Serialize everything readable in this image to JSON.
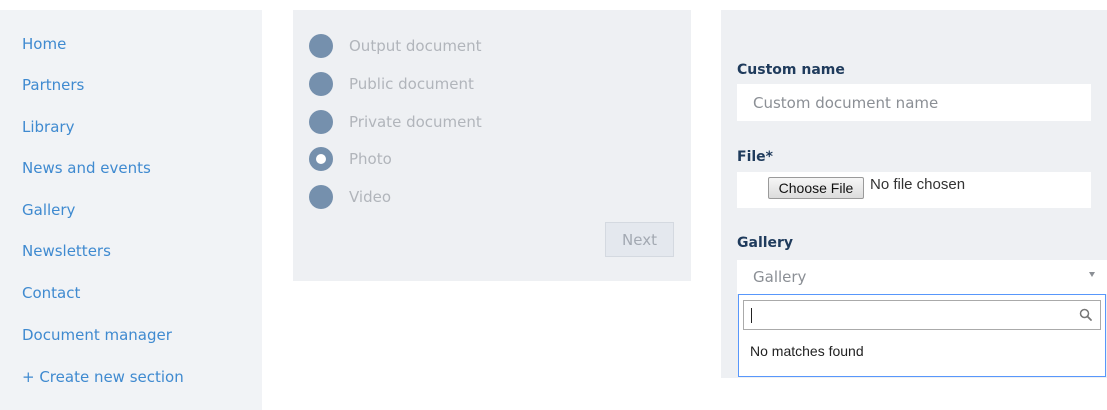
{
  "sidebar": {
    "items": [
      {
        "label": "Home"
      },
      {
        "label": "Partners"
      },
      {
        "label": "Library"
      },
      {
        "label": "News and events"
      },
      {
        "label": "Gallery"
      },
      {
        "label": "Newsletters"
      },
      {
        "label": "Contact"
      },
      {
        "label": "Document manager"
      },
      {
        "label": "+ Create new section"
      }
    ]
  },
  "document_type": {
    "options": [
      {
        "label": "Output document",
        "checked": false
      },
      {
        "label": "Public document",
        "checked": false
      },
      {
        "label": "Private document",
        "checked": false
      },
      {
        "label": "Photo",
        "checked": true
      },
      {
        "label": "Video",
        "checked": false
      }
    ],
    "next_label": "Next"
  },
  "form": {
    "custom_name_label": "Custom name",
    "custom_name_placeholder": "Custom document name",
    "file_label": "File*",
    "choose_file_label": "Choose File",
    "no_file_text": "No file chosen",
    "gallery_label": "Gallery",
    "gallery_selected": "Gallery",
    "dropdown_search_value": "",
    "no_matches_text": "No matches found"
  },
  "colors": {
    "link": "#3f8ad0",
    "radio": "#7590ad",
    "label_dark": "#1f3b5c",
    "panel_bg": "#eef0f3",
    "focus_border": "#5897fb"
  }
}
